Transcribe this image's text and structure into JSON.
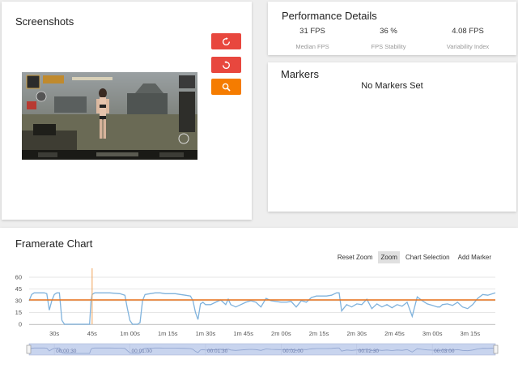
{
  "screenshots": {
    "title": "Screenshots",
    "buttons": [
      "rotate-left",
      "rotate-right",
      "zoom"
    ]
  },
  "performance": {
    "title": "Performance Details",
    "stats": [
      {
        "value": "31 FPS",
        "label": "Median FPS"
      },
      {
        "value": "36 %",
        "label": "FPS Stability"
      },
      {
        "value": "4.08 FPS",
        "label": "Variability Index"
      }
    ]
  },
  "markers": {
    "title": "Markers",
    "empty_text": "No Markers Set"
  },
  "framerate_chart": {
    "title": "Framerate Chart",
    "toolbar": [
      "Reset Zoom",
      "Zoom",
      "Chart Selection",
      "Add Marker"
    ],
    "active_tool": "Zoom",
    "colors": {
      "series": "#7fb2dc",
      "median": "#e8721c",
      "cursor": "#f0a45a",
      "navigator": "#c8d4ee"
    }
  },
  "chart_data": {
    "type": "line",
    "title": "Framerate Chart",
    "ylim": [
      0,
      60
    ],
    "y_ticks": [
      "60",
      "45",
      "30",
      "15",
      "0"
    ],
    "x_unit": "seconds",
    "xlim": [
      20,
      205
    ],
    "x_tick_values": [
      30,
      45,
      60,
      75,
      90,
      105,
      120,
      135,
      150,
      165,
      180,
      195
    ],
    "x_ticks": [
      "30s",
      "45s",
      "1m 00s",
      "1m 15s",
      "1m 30s",
      "1m 45s",
      "2m 00s",
      "2m 15s",
      "2m 30s",
      "2m 45s",
      "3m 00s",
      "3m 15s"
    ],
    "median_line": 31,
    "cursor_x": 45,
    "navigator_ticks": [
      "00:00:30",
      "00:01:00",
      "00:01:30",
      "00:02:00",
      "00:02:30",
      "00:03:00"
    ],
    "series": [
      {
        "x": [
          20,
          21,
          22,
          24,
          26,
          27,
          28,
          29,
          30,
          31,
          32,
          33,
          34,
          35,
          36,
          38,
          40,
          42,
          44,
          44.5,
          45,
          46,
          48,
          52,
          56,
          58,
          59,
          60,
          61,
          62,
          63,
          64,
          65,
          66,
          68,
          70,
          72,
          74,
          76,
          78,
          80,
          82,
          84,
          85,
          86,
          87,
          88,
          89,
          90,
          92,
          94,
          96,
          98,
          99,
          100,
          102,
          104,
          106,
          108,
          110,
          112,
          114,
          116,
          118,
          120,
          122,
          124,
          126,
          128,
          130,
          132,
          134,
          136,
          138,
          140,
          142,
          143,
          144,
          146,
          148,
          150,
          152,
          154,
          156,
          158,
          160,
          162,
          164,
          166,
          168,
          170,
          172,
          174,
          176,
          178,
          180,
          182,
          183,
          184,
          186,
          188,
          190,
          192,
          194,
          196,
          198,
          200,
          202,
          205
        ],
        "y": [
          30,
          38,
          40,
          40,
          40,
          39,
          18,
          30,
          38,
          40,
          40,
          5,
          0,
          0,
          0,
          0,
          0,
          0,
          0,
          28,
          38,
          40,
          40,
          40,
          39,
          37,
          20,
          5,
          0,
          0,
          0,
          2,
          30,
          38,
          39,
          40,
          40,
          39,
          39,
          39,
          38,
          37,
          36,
          30,
          15,
          6,
          26,
          28,
          25,
          25,
          28,
          31,
          25,
          32,
          25,
          22,
          25,
          28,
          30,
          28,
          22,
          33,
          30,
          29,
          28,
          28,
          29,
          22,
          30,
          28,
          34,
          36,
          36,
          36,
          37,
          40,
          40,
          17,
          25,
          22,
          26,
          25,
          32,
          20,
          26,
          22,
          25,
          21,
          25,
          23,
          28,
          10,
          35,
          30,
          26,
          24,
          22,
          22,
          25,
          26,
          24,
          28,
          22,
          20,
          25,
          33,
          38,
          37,
          40
        ]
      }
    ]
  }
}
